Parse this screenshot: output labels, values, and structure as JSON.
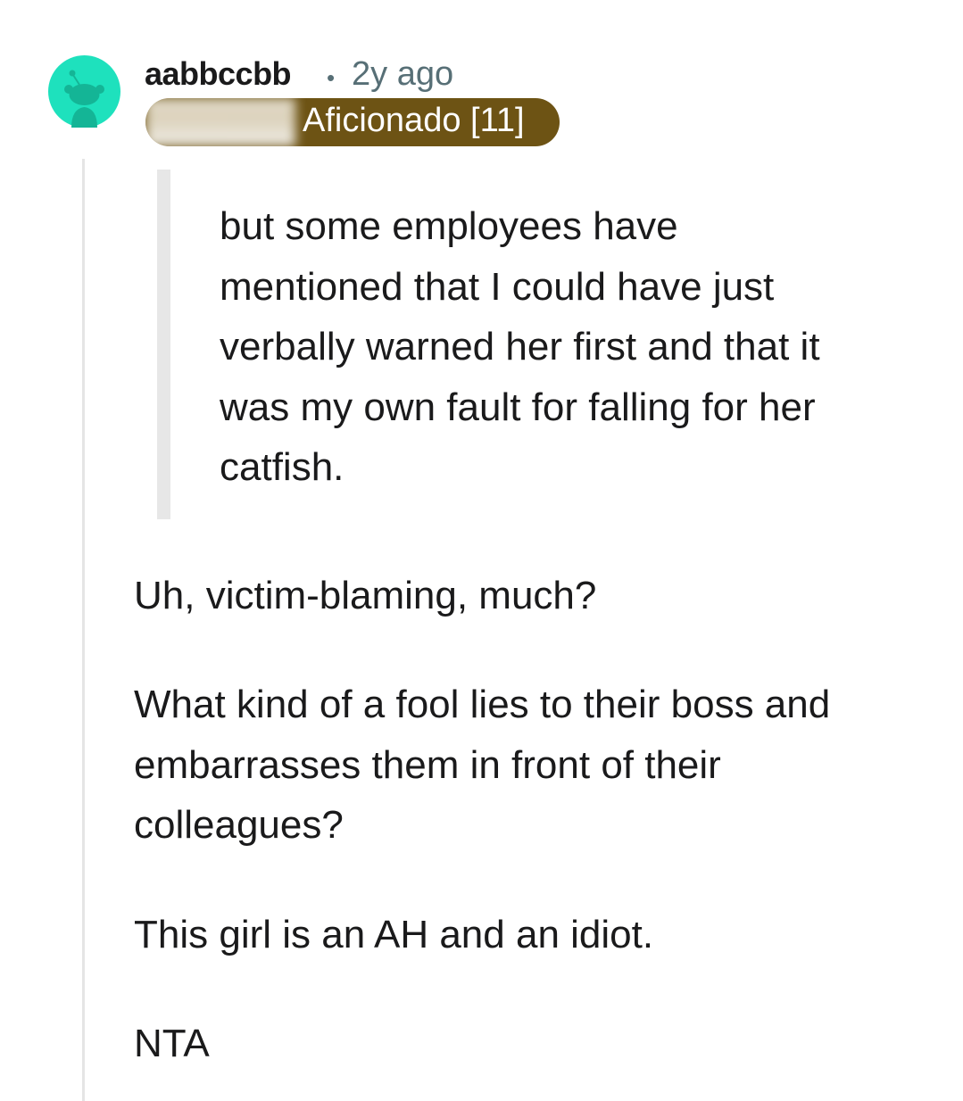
{
  "comment": {
    "username": "aabbccbb",
    "separator": "•",
    "age": "2y ago",
    "flair": "Aficionado [11]",
    "quote": "but some employees have mentioned that I could have just verbally warned her first and that it was my own fault for falling for her catfish.",
    "paragraphs": [
      "Uh, victim-blaming, much?",
      "What kind of a fool lies to their boss and embarrasses them in front of their colleagues?",
      "This girl is an AH and an idiot.",
      "NTA"
    ]
  },
  "icons": {
    "avatar": "reddit-snoo-avatar-icon"
  },
  "colors": {
    "avatar_bg": "#1ee1bd",
    "avatar_figure": "#14b596",
    "flair_bg": "#6d5314",
    "flair_text": "#ffffff",
    "meta_text": "#576f76",
    "body_text": "#1a1a1b",
    "quote_bar": "#e7e7e7",
    "thread_line": "#e5e5e5"
  }
}
